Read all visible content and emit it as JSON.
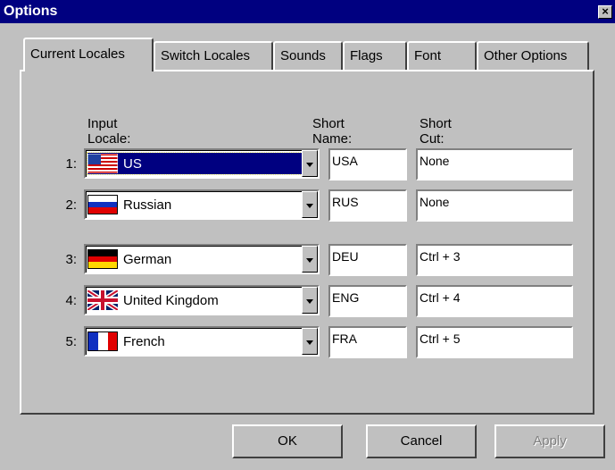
{
  "window": {
    "title": "Options",
    "close_label": "×"
  },
  "tabs": [
    "Current Locales",
    "Switch Locales",
    "Sounds",
    "Flags",
    "Font",
    "Other Options"
  ],
  "active_tab": "Current Locales",
  "headers": {
    "input_locale": "Input Locale:",
    "short_name": "Short Name:",
    "short_cut": "Short Cut:"
  },
  "rows": [
    {
      "num": "1:",
      "locale": "US",
      "flag": "us-flag-icon",
      "short_name": "USA",
      "short_cut": "None",
      "selected": true
    },
    {
      "num": "2:",
      "locale": "Russian",
      "flag": "russia-flag-icon",
      "short_name": "RUS",
      "short_cut": "None"
    },
    {
      "num": "3:",
      "locale": "German",
      "flag": "germany-flag-icon",
      "short_name": "DEU",
      "short_cut": "Ctrl + 3"
    },
    {
      "num": "4:",
      "locale": "United Kingdom",
      "flag": "uk-flag-icon",
      "short_name": "ENG",
      "short_cut": "Ctrl + 4"
    },
    {
      "num": "5:",
      "locale": "French",
      "flag": "france-flag-icon",
      "short_name": "FRA",
      "short_cut": "Ctrl + 5"
    }
  ],
  "buttons": {
    "ok": "OK",
    "cancel": "Cancel",
    "apply": "Apply"
  },
  "colors": {
    "title_bar": "#000080",
    "face": "#c0c0c0",
    "selection": "#000080"
  }
}
